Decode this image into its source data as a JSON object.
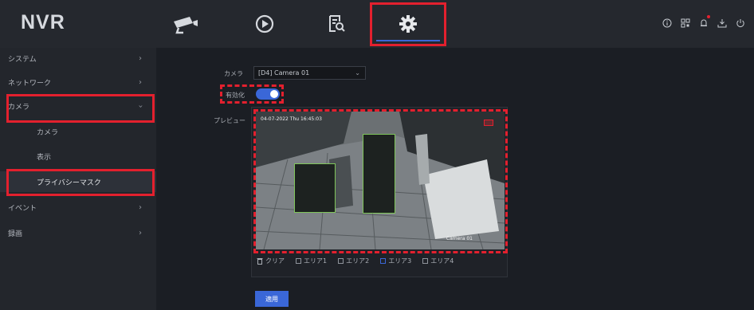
{
  "app": {
    "logo": "NVR"
  },
  "nav": {
    "icons": [
      "camera-icon",
      "playback-icon",
      "search-icon",
      "settings-icon"
    ],
    "active": "settings-icon",
    "right_icons": [
      "info-icon",
      "qr-icon",
      "bell-icon",
      "download-icon",
      "power-icon"
    ]
  },
  "sidebar": {
    "items": [
      {
        "label": "システム"
      },
      {
        "label": "ネットワーク"
      },
      {
        "label": "カメラ"
      },
      {
        "label": "カメラ"
      },
      {
        "label": "表示"
      },
      {
        "label": "プライバシーマスク"
      },
      {
        "label": "イベント"
      },
      {
        "label": "録画"
      }
    ]
  },
  "form": {
    "camera_label": "カメラ",
    "camera_value": "[D4] Camera 01",
    "enable_label": "有効化",
    "enable_on": true,
    "preview_label": "プレビュー"
  },
  "video": {
    "osd_time": "04-07-2022 Thu 16:45:03",
    "osd_camera": "Camera 01"
  },
  "legend": {
    "clear": "クリア",
    "areas": [
      "エリア1",
      "エリア2",
      "エリア3",
      "エリア4"
    ]
  },
  "buttons": {
    "apply": "適用"
  },
  "colors": {
    "accent": "#3a67d8",
    "highlight": "#e3202e",
    "mask_border": "#7fc55a"
  }
}
